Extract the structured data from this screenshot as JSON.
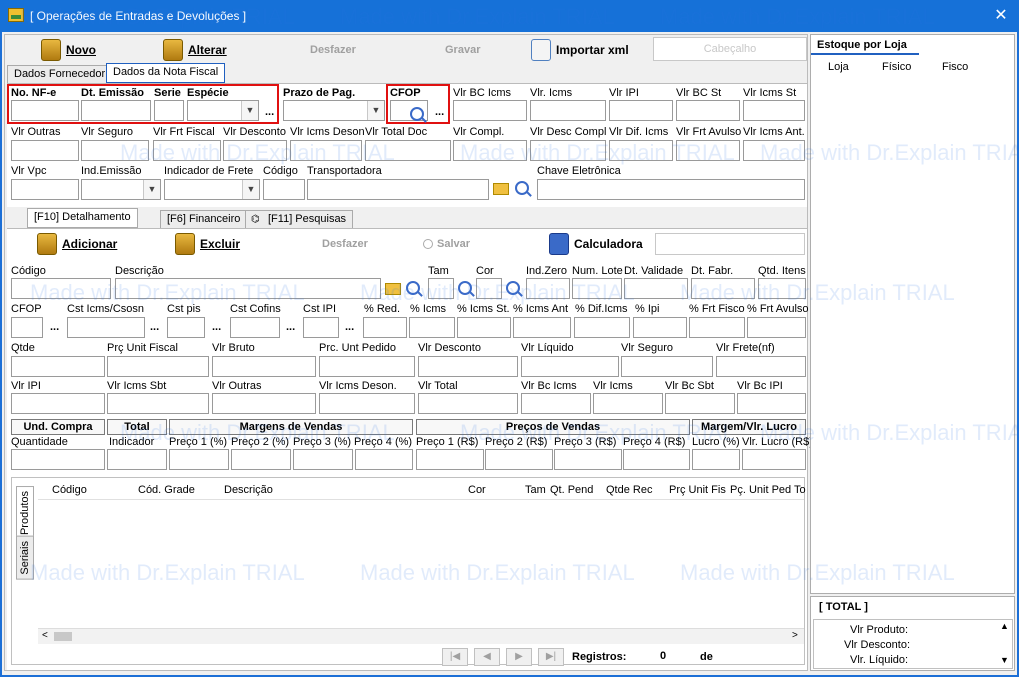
{
  "window": {
    "title": "[ Operações de Entradas e Devoluções ]"
  },
  "toolbar": {
    "novo": "Novo",
    "alterar": "Alterar",
    "desfazer": "Desfazer",
    "gravar": "Gravar",
    "importar_xml": "Importar xml",
    "cabecalho": "Cabeçalho"
  },
  "main_tabs": [
    "Dados Fornecedor",
    "Dados da Nota Fiscal"
  ],
  "header_fields": {
    "no_nfe": "No. NF-e",
    "dt_emissao": "Dt. Emissão",
    "serie": "Serie",
    "especie": "Espécie",
    "prazo_pag": "Prazo de Pag.",
    "cfop": "CFOP",
    "vlr_bc_icms": "Vlr BC Icms",
    "vlr_icms": "Vlr. Icms",
    "vlr_ipi": "Vlr IPI",
    "vlr_bc_st": "Vlr BC St",
    "vlr_icms_st": "Vlr Icms St",
    "vlr_outras": "Vlr Outras",
    "vlr_seguro": "Vlr Seguro",
    "vlr_frt_fiscal": "Vlr Frt Fiscal",
    "vlr_desconto": "Vlr Desconto",
    "vlr_icms_deson": "Vlr Icms Deson",
    "vlr_total_doc": "Vlr Total Doc",
    "vlr_compl": "Vlr Compl.",
    "vlr_desc_compl": "Vlr Desc Compl",
    "vlr_dif_icms": "Vlr Dif. Icms",
    "vlr_frt_avulso": "Vlr Frt Avulso",
    "vlr_icms_ant": "Vlr Icms Ant.",
    "vlr_vpc": "Vlr Vpc",
    "ind_emissao": "Ind.Emissão",
    "indicador_frete": "Indicador de Frete",
    "codigo": "Código",
    "transportadora": "Transportadora",
    "chave_eletronica": "Chave Eletrônica"
  },
  "item_tabs": [
    "[F10] Detalhamento",
    "[F6] Financeiro",
    "[F11] Pesquisas"
  ],
  "item_toolbar": {
    "adicionar": "Adicionar",
    "excluir": "Excluir",
    "desfazer": "Desfazer",
    "salvar": "Salvar",
    "calculadora": "Calculadora"
  },
  "item_fields": {
    "codigo": "Código",
    "descricao": "Descrição",
    "tam": "Tam",
    "cor": "Cor",
    "ind_zero": "Ind.Zero",
    "num_lote": "Num. Lote",
    "dt_validade": "Dt. Validade",
    "dt_fabr": "Dt. Fabr.",
    "qtd_itens": "Qtd. Itens",
    "cfop": "CFOP",
    "cst_icms": "Cst Icms/Csosn",
    "cst_pis": "Cst pis",
    "cst_cofins": "Cst Cofins",
    "cst_ipi": "Cst IPI",
    "pct_red": "% Red.",
    "pct_icms": "% Icms",
    "pct_icms_st": "% Icms St.",
    "pct_icms_ant": "% Icms Ant",
    "pct_dif_icms": "% Dif.Icms",
    "pct_ipi": "% Ipi",
    "pct_frt_fisco": "% Frt Fisco",
    "pct_frt_avulso": "% Frt Avulso",
    "qtde": "Qtde",
    "prc_unit_fiscal": "Prç Unit Fiscal",
    "vlr_bruto": "Vlr Bruto",
    "prc_unt_pedido": "Prc. Unt Pedido",
    "vlr_desconto": "Vlr Desconto",
    "vlr_liquido": "Vlr Líquido",
    "vlr_seguro": "Vlr Seguro",
    "vlr_frete_nf": "Vlr Frete(nf)",
    "vlr_ipi": "Vlr IPI",
    "vlr_icms_sbt": "Vlr Icms Sbt",
    "vlr_outras": "Vlr Outras",
    "vlr_icms_deson": "Vlr Icms Deson.",
    "vlr_total": "Vlr Total",
    "vlr_bc_icms": "Vlr Bc Icms",
    "vlr_icms": "Vlr Icms",
    "vlr_bc_sbt": "Vlr Bc Sbt",
    "vlr_bc_ipi": "Vlr Bc IPI"
  },
  "group_headers": {
    "und_compra": "Und. Compra",
    "total": "Total",
    "margens": "Margens de Vendas",
    "precos": "Preços de Vendas",
    "margem_lucro": "Margem/Vlr. Lucro"
  },
  "group_fields": {
    "quantidade": "Quantidade",
    "indicador": "Indicador",
    "preco1": "Preço 1 (%)",
    "preco2": "Preço 2 (%)",
    "preco3": "Preço 3 (%)",
    "preco4": "Preço 4 (%)",
    "preco1r": "Preço 1 (R$)",
    "preco2r": "Preço 2 (R$)",
    "preco3r": "Preço 3 (R$)",
    "preco4r": "Preço 4 (R$)",
    "lucro_pct": "Lucro (%)",
    "vlr_lucro": "Vlr. Lucro (R$)"
  },
  "grid": {
    "columns": [
      "Código",
      "Cód. Grade",
      "Descrição",
      "Cor",
      "Tam",
      "Qt. Pend",
      "Qtde Rec",
      "Prç Unit Fis",
      "Pç. Unit Ped To"
    ],
    "side_tabs": [
      "Produtos",
      "Seriais"
    ],
    "registros_label": "Registros:",
    "registros_value": "0",
    "de_label": "de"
  },
  "right_panel": {
    "title": "Estoque por Loja",
    "columns": [
      "Loja",
      "Físico",
      "Fisco"
    ],
    "total_title": "[ TOTAL ]",
    "vlr_produto": "Vlr Produto:",
    "vlr_desconto": "Vlr Desconto:",
    "vlr_liquido": "Vlr. Líquido:"
  },
  "watermark": "Made with Dr.Explain TRIAL"
}
